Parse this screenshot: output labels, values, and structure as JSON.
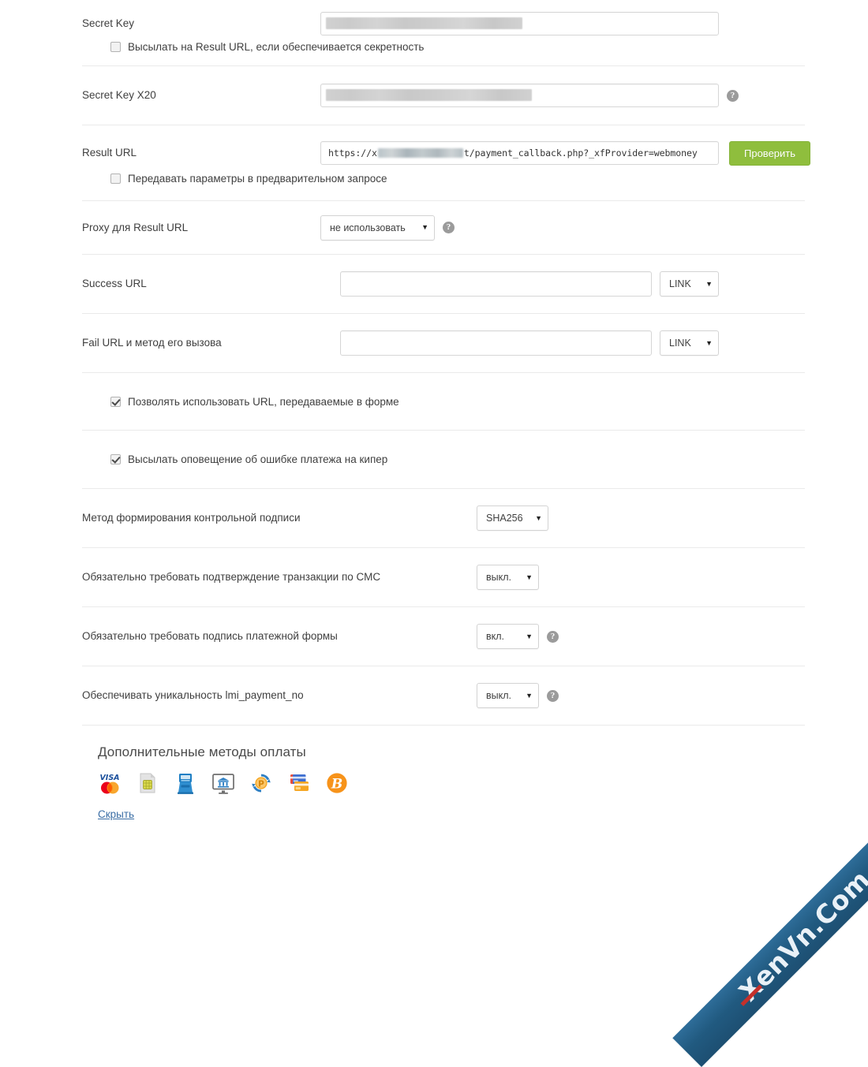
{
  "form": {
    "rows": [
      {
        "id": "secret-key",
        "label": "Secret Key",
        "value": "",
        "placeholder": "",
        "sub_checkbox": {
          "label": "Высылать на Result URL, если обеспечивается секретность",
          "checked": false
        }
      },
      {
        "id": "secret-key-x20",
        "label": "Secret Key X20",
        "value": "",
        "placeholder": "",
        "help": "?"
      },
      {
        "id": "result-url",
        "label": "Result URL",
        "value_prefix": "https://x",
        "value_suffix": "t/payment_callback.php?_xfProvider=webmoney",
        "button": "Проверить",
        "sub_checkbox": {
          "label": "Передавать параметры в предварительном запросе",
          "checked": false
        }
      },
      {
        "id": "proxy-result-url",
        "label": "Proxy для Result URL",
        "select_value": "не использовать",
        "help": "?"
      },
      {
        "id": "success-url",
        "label": "Success URL",
        "value": "",
        "select_value": "LINK"
      },
      {
        "id": "fail-url",
        "label": "Fail URL и метод его вызова",
        "value": "",
        "select_value": "LINK"
      }
    ],
    "checkbox_rows": [
      {
        "id": "allow-form-urls",
        "label": "Позволять использовать URL, передаваемые в форме",
        "checked": true
      },
      {
        "id": "notify-payment-error",
        "label": "Высылать оповещение об ошибке платежа на кипер",
        "checked": true
      }
    ],
    "select_rows": [
      {
        "id": "signature-method",
        "label": "Метод формирования контрольной подписи",
        "value": "SHA256",
        "help": null
      },
      {
        "id": "require-sms-confirm",
        "label": "Обязательно требовать подтверждение транзакции по СМС",
        "value": "выкл.",
        "help": null
      },
      {
        "id": "require-form-signature",
        "label": "Обязательно требовать подпись платежной формы",
        "value": "вкл.",
        "help": "?"
      },
      {
        "id": "unique-payment-no",
        "label": "Обеспечивать уникальность lmi_payment_no",
        "value": "выкл.",
        "help": "?"
      }
    ]
  },
  "extra_methods": {
    "title": "Дополнительные методы оплаты",
    "hide_link": "Скрыть",
    "icons": [
      {
        "name": "visa-mastercard-icon",
        "title": "VISA / MasterCard",
        "label": "VISA"
      },
      {
        "name": "sim-card-icon",
        "title": "SIM"
      },
      {
        "name": "payment-terminal-icon",
        "title": "Терминал"
      },
      {
        "name": "internet-banking-icon",
        "title": "Интернет-банк"
      },
      {
        "name": "currency-exchange-icon",
        "title": "Обмен"
      },
      {
        "name": "bank-cards-icon",
        "title": "Банковские карты"
      },
      {
        "name": "bitcoin-icon",
        "title": "Bitcoin"
      }
    ]
  },
  "watermark": {
    "text": "XenVn.Com"
  },
  "colors": {
    "accent_green": "#8fbe3d",
    "link_blue": "#3b6ea5",
    "divider": "#eaeaea",
    "text": "#3f3f3f",
    "ribbon_blue": "#215a80"
  }
}
